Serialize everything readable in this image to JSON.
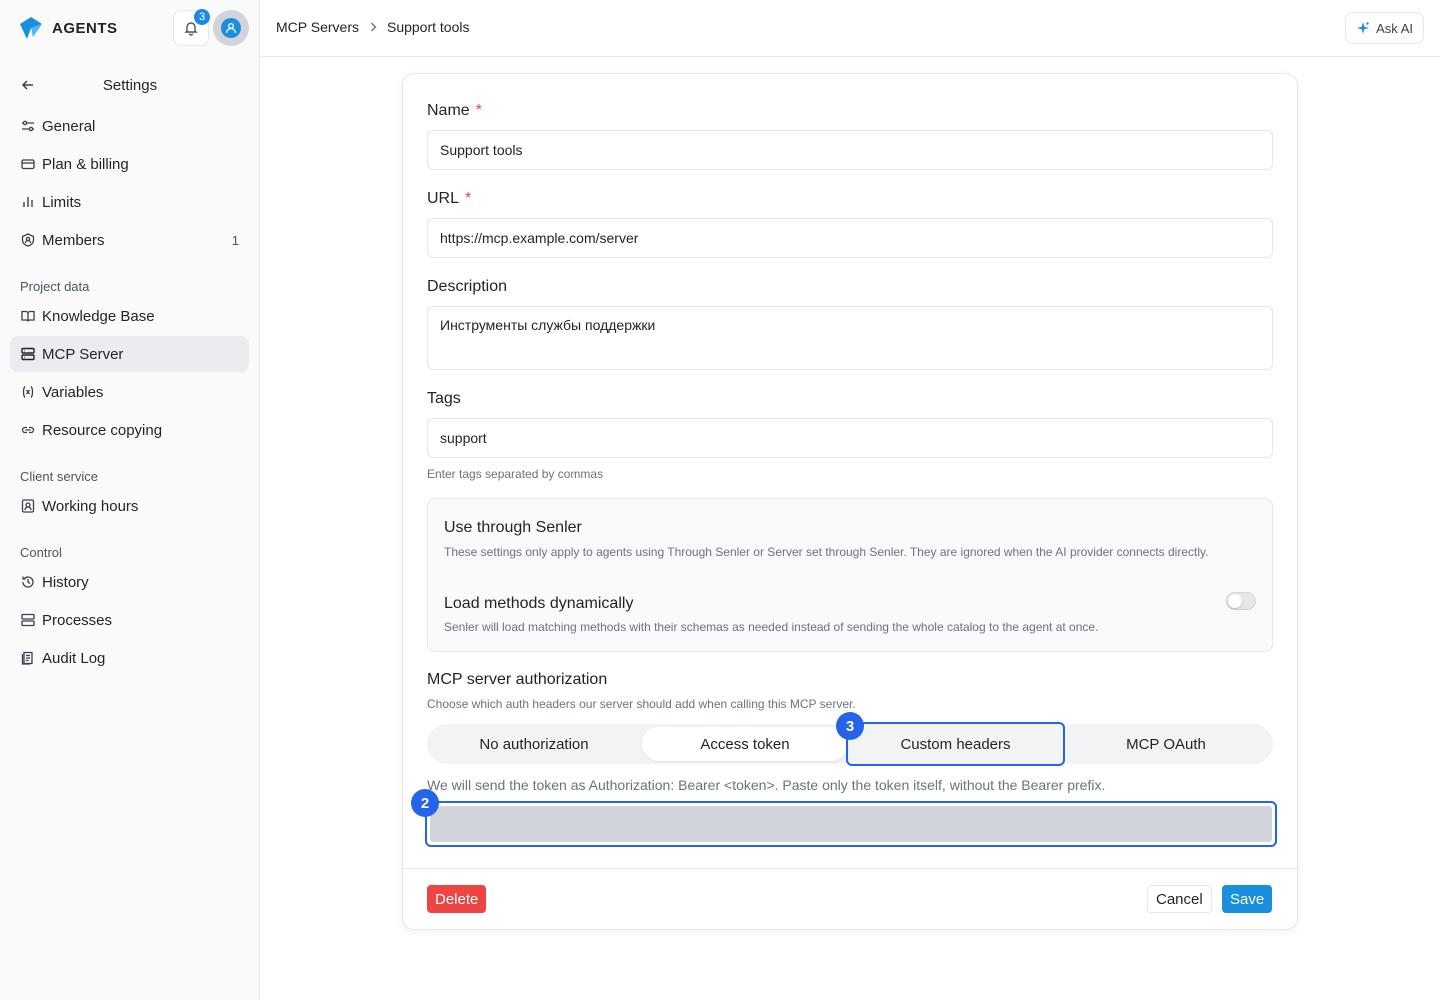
{
  "app": {
    "brand": "AGENTS",
    "notifications_count": "3"
  },
  "sidebar": {
    "title": "Settings",
    "items": [
      {
        "label": "General",
        "icon": "sliders-icon"
      },
      {
        "label": "Plan & billing",
        "icon": "credit-card-icon"
      },
      {
        "label": "Limits",
        "icon": "bar-chart-icon"
      },
      {
        "label": "Members",
        "icon": "shield-user-icon",
        "count": "1"
      }
    ],
    "sections": [
      {
        "title": "Project data",
        "items": [
          {
            "label": "Knowledge Base",
            "icon": "book-icon"
          },
          {
            "label": "MCP Server",
            "icon": "server-icon",
            "active": true
          },
          {
            "label": "Variables",
            "icon": "variable-icon"
          },
          {
            "label": "Resource copying",
            "icon": "link-icon"
          }
        ]
      },
      {
        "title": "Client service",
        "items": [
          {
            "label": "Working hours",
            "icon": "clock-badge-icon"
          }
        ]
      },
      {
        "title": "Control",
        "items": [
          {
            "label": "History",
            "icon": "history-icon"
          },
          {
            "label": "Processes",
            "icon": "processes-icon"
          },
          {
            "label": "Audit Log",
            "icon": "audit-log-icon"
          }
        ]
      }
    ]
  },
  "topbar": {
    "breadcrumb": [
      "MCP Servers",
      "Support tools"
    ],
    "ask_ai": "Ask AI"
  },
  "form": {
    "name": {
      "label": "Name",
      "required": "*",
      "value": "Support tools"
    },
    "url": {
      "label": "URL",
      "required": "*",
      "value": "https://mcp.example.com/server"
    },
    "description": {
      "label": "Description",
      "value": "Инструменты службы поддержки"
    },
    "tags": {
      "label": "Tags",
      "value": "support",
      "hint": "Enter tags separated by commas"
    },
    "senler": {
      "title": "Use through Senler",
      "description": "These settings only apply to agents using Through Senler or Server set through Senler. They are ignored when the AI provider connects directly.",
      "dynamic_title": "Load methods dynamically",
      "dynamic_description": "Senler will load matching methods with their schemas as needed instead of sending the whole catalog to the agent at once.",
      "dynamic_enabled": false
    },
    "auth": {
      "title": "MCP server authorization",
      "description": "Choose which auth headers our server should add when calling this MCP server.",
      "options": [
        "No authorization",
        "Access token",
        "Custom headers",
        "MCP OAuth"
      ],
      "selected": "Access token",
      "token_note": "We will send the token as Authorization: Bearer <token>. Paste only the token itself, without the Bearer prefix.",
      "token_value": ""
    },
    "markers": {
      "token_field": "2",
      "custom_headers": "3"
    },
    "buttons": {
      "delete": "Delete",
      "cancel": "Cancel",
      "save": "Save"
    }
  },
  "colors": {
    "accent": "#1a8fdd",
    "danger": "#ef4444",
    "highlight": "#2563eb"
  }
}
